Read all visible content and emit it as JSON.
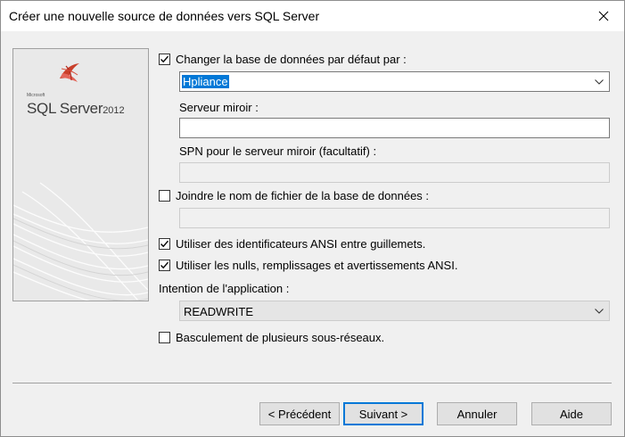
{
  "window": {
    "title": "Créer une nouvelle source de données vers SQL Server"
  },
  "logo": {
    "vendor": "Microsoft",
    "product": "SQL Server",
    "version": "2012"
  },
  "form": {
    "change_db": {
      "label": "Changer la base de données par défaut par :",
      "checked": true
    },
    "database_value": "Hpliance",
    "mirror_server": {
      "label": "Serveur miroir :",
      "value": ""
    },
    "mirror_spn": {
      "label": "SPN pour le serveur miroir (facultatif) :",
      "value": ""
    },
    "attach_db": {
      "label": "Joindre le nom de fichier de la base de données :",
      "checked": false,
      "value": ""
    },
    "ansi_quoted": {
      "label": "Utiliser des identificateurs ANSI entre guillemets.",
      "checked": true
    },
    "ansi_nulls": {
      "label": "Utiliser les nulls, remplissages et avertissements ANSI.",
      "checked": true
    },
    "app_intent": {
      "label": "Intention de l'application :",
      "value": "READWRITE"
    },
    "multisubnet": {
      "label": "Basculement de plusieurs sous-réseaux.",
      "checked": false
    }
  },
  "buttons": {
    "back": "< Précédent",
    "next": "Suivant >",
    "cancel": "Annuler",
    "help": "Aide"
  },
  "colors": {
    "selection": "#0078d7",
    "dialog_bg": "#f0f0f0"
  }
}
